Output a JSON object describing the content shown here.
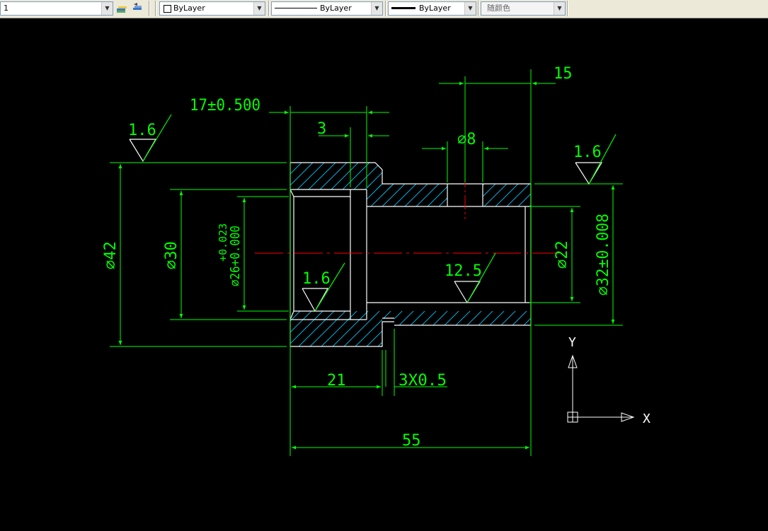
{
  "toolbar": {
    "layer_value": "1",
    "color_value": "ByLayer",
    "linetype_value": "ByLayer",
    "lineweight_value": "ByLayer",
    "plotstyle_value": "随颜色"
  },
  "colors": {
    "dimension": "#00ff00",
    "outline": "#ffffff",
    "hatch": "#00c8ff",
    "centerline": "#ff0000",
    "background": "#000000"
  },
  "dimensions": {
    "d17": "17±0.500",
    "d3": "3",
    "d15": "15",
    "d8": "⌀8",
    "d42": "⌀42",
    "d30": "⌀30",
    "d26": "⌀26+0.000",
    "d26_tol": "+0.023",
    "d22": "⌀22",
    "d32": "⌀32±0.008",
    "d21": "21",
    "chamfer": "3X0.5",
    "d55": "55"
  },
  "roughness": {
    "left_top": "1.6",
    "right_top": "1.6",
    "bore": "1.6",
    "inner": "12.5"
  },
  "ucs": {
    "x_label": "X",
    "y_label": "Y"
  }
}
